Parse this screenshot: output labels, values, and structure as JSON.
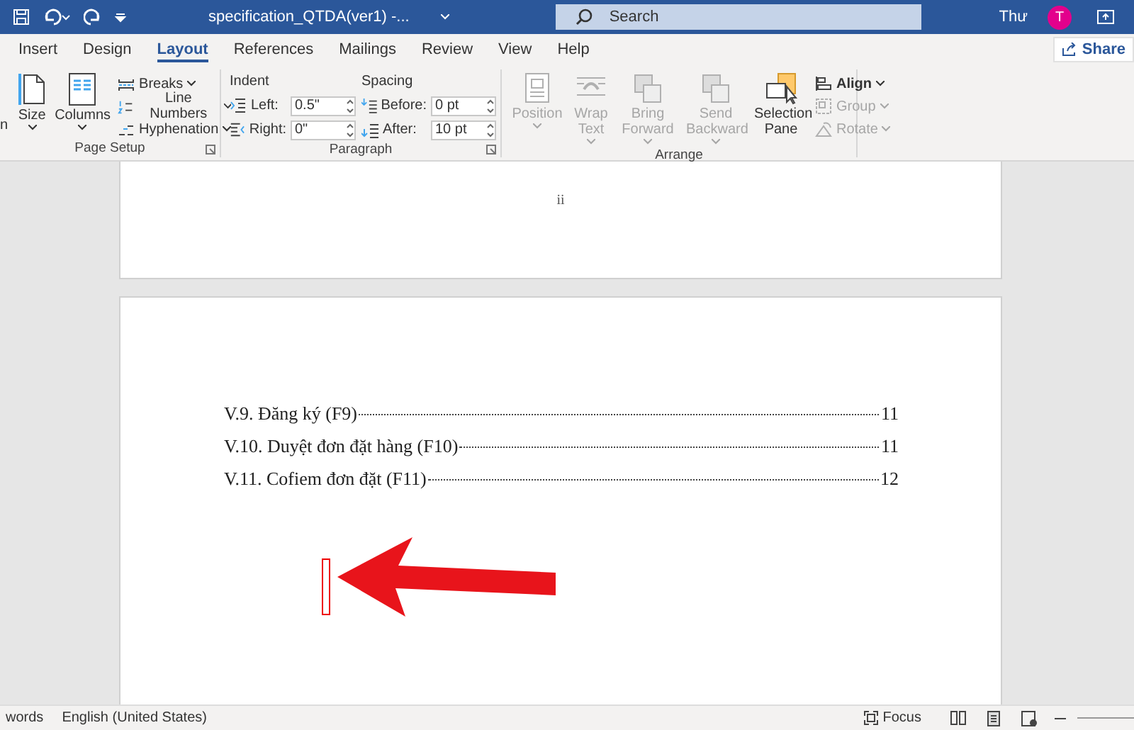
{
  "title_bar": {
    "title": "specification_QTDA(ver1) -...",
    "search": {
      "placeholder": "Search"
    },
    "user": {
      "name": "Thư",
      "initial": "T"
    }
  },
  "tabs": [
    {
      "label": "Insert",
      "selected": false
    },
    {
      "label": "Design",
      "selected": false
    },
    {
      "label": "Layout",
      "selected": true
    },
    {
      "label": "References",
      "selected": false
    },
    {
      "label": "Mailings",
      "selected": false
    },
    {
      "label": "Review",
      "selected": false
    },
    {
      "label": "View",
      "selected": false
    },
    {
      "label": "Help",
      "selected": false
    }
  ],
  "share": "Share",
  "ribbon": {
    "page_setup": {
      "cut_label": "n",
      "size": "Size",
      "columns": "Columns",
      "breaks": "Breaks",
      "line_numbers": "Line Numbers",
      "hyphenation": "Hyphenation",
      "group": "Page Setup"
    },
    "paragraph": {
      "indent": "Indent",
      "spacing": "Spacing",
      "group": "Paragraph",
      "fields": [
        {
          "kind": "left",
          "label": "Left:",
          "value": "0.5\""
        },
        {
          "kind": "right",
          "label": "Right:",
          "value": "0\""
        },
        {
          "kind": "before",
          "label": "Before:",
          "value": "0 pt"
        },
        {
          "kind": "after",
          "label": "After:",
          "value": "10 pt"
        }
      ]
    },
    "arrange": {
      "group": "Arrange",
      "buttons": [
        {
          "kind": "position",
          "label": "Position",
          "disabled": true
        },
        {
          "kind": "wrap",
          "label": "Wrap Text",
          "disabled": true
        },
        {
          "kind": "bring",
          "label": "Bring Forward",
          "disabled": true
        },
        {
          "kind": "send",
          "label": "Send Backward",
          "disabled": true
        },
        {
          "kind": "selection",
          "label": "Selection Pane",
          "disabled": false
        }
      ],
      "small": [
        {
          "kind": "align",
          "label": "Align",
          "disabled": false
        },
        {
          "kind": "group",
          "label": "Group",
          "disabled": true
        },
        {
          "kind": "rotate",
          "label": "Rotate",
          "disabled": true
        }
      ]
    }
  },
  "document": {
    "page_number": "ii",
    "toc": [
      {
        "title": "V.9. Đăng ký (F9)",
        "page": "11"
      },
      {
        "title": "V.10. Duyệt đơn đặt hàng (F10)",
        "page": "11"
      },
      {
        "title": "V.11. Cofiem đơn đặt (F11)",
        "page": "12"
      }
    ]
  },
  "status_bar": {
    "words": "words",
    "language": "English (United States)",
    "focus": "Focus"
  }
}
